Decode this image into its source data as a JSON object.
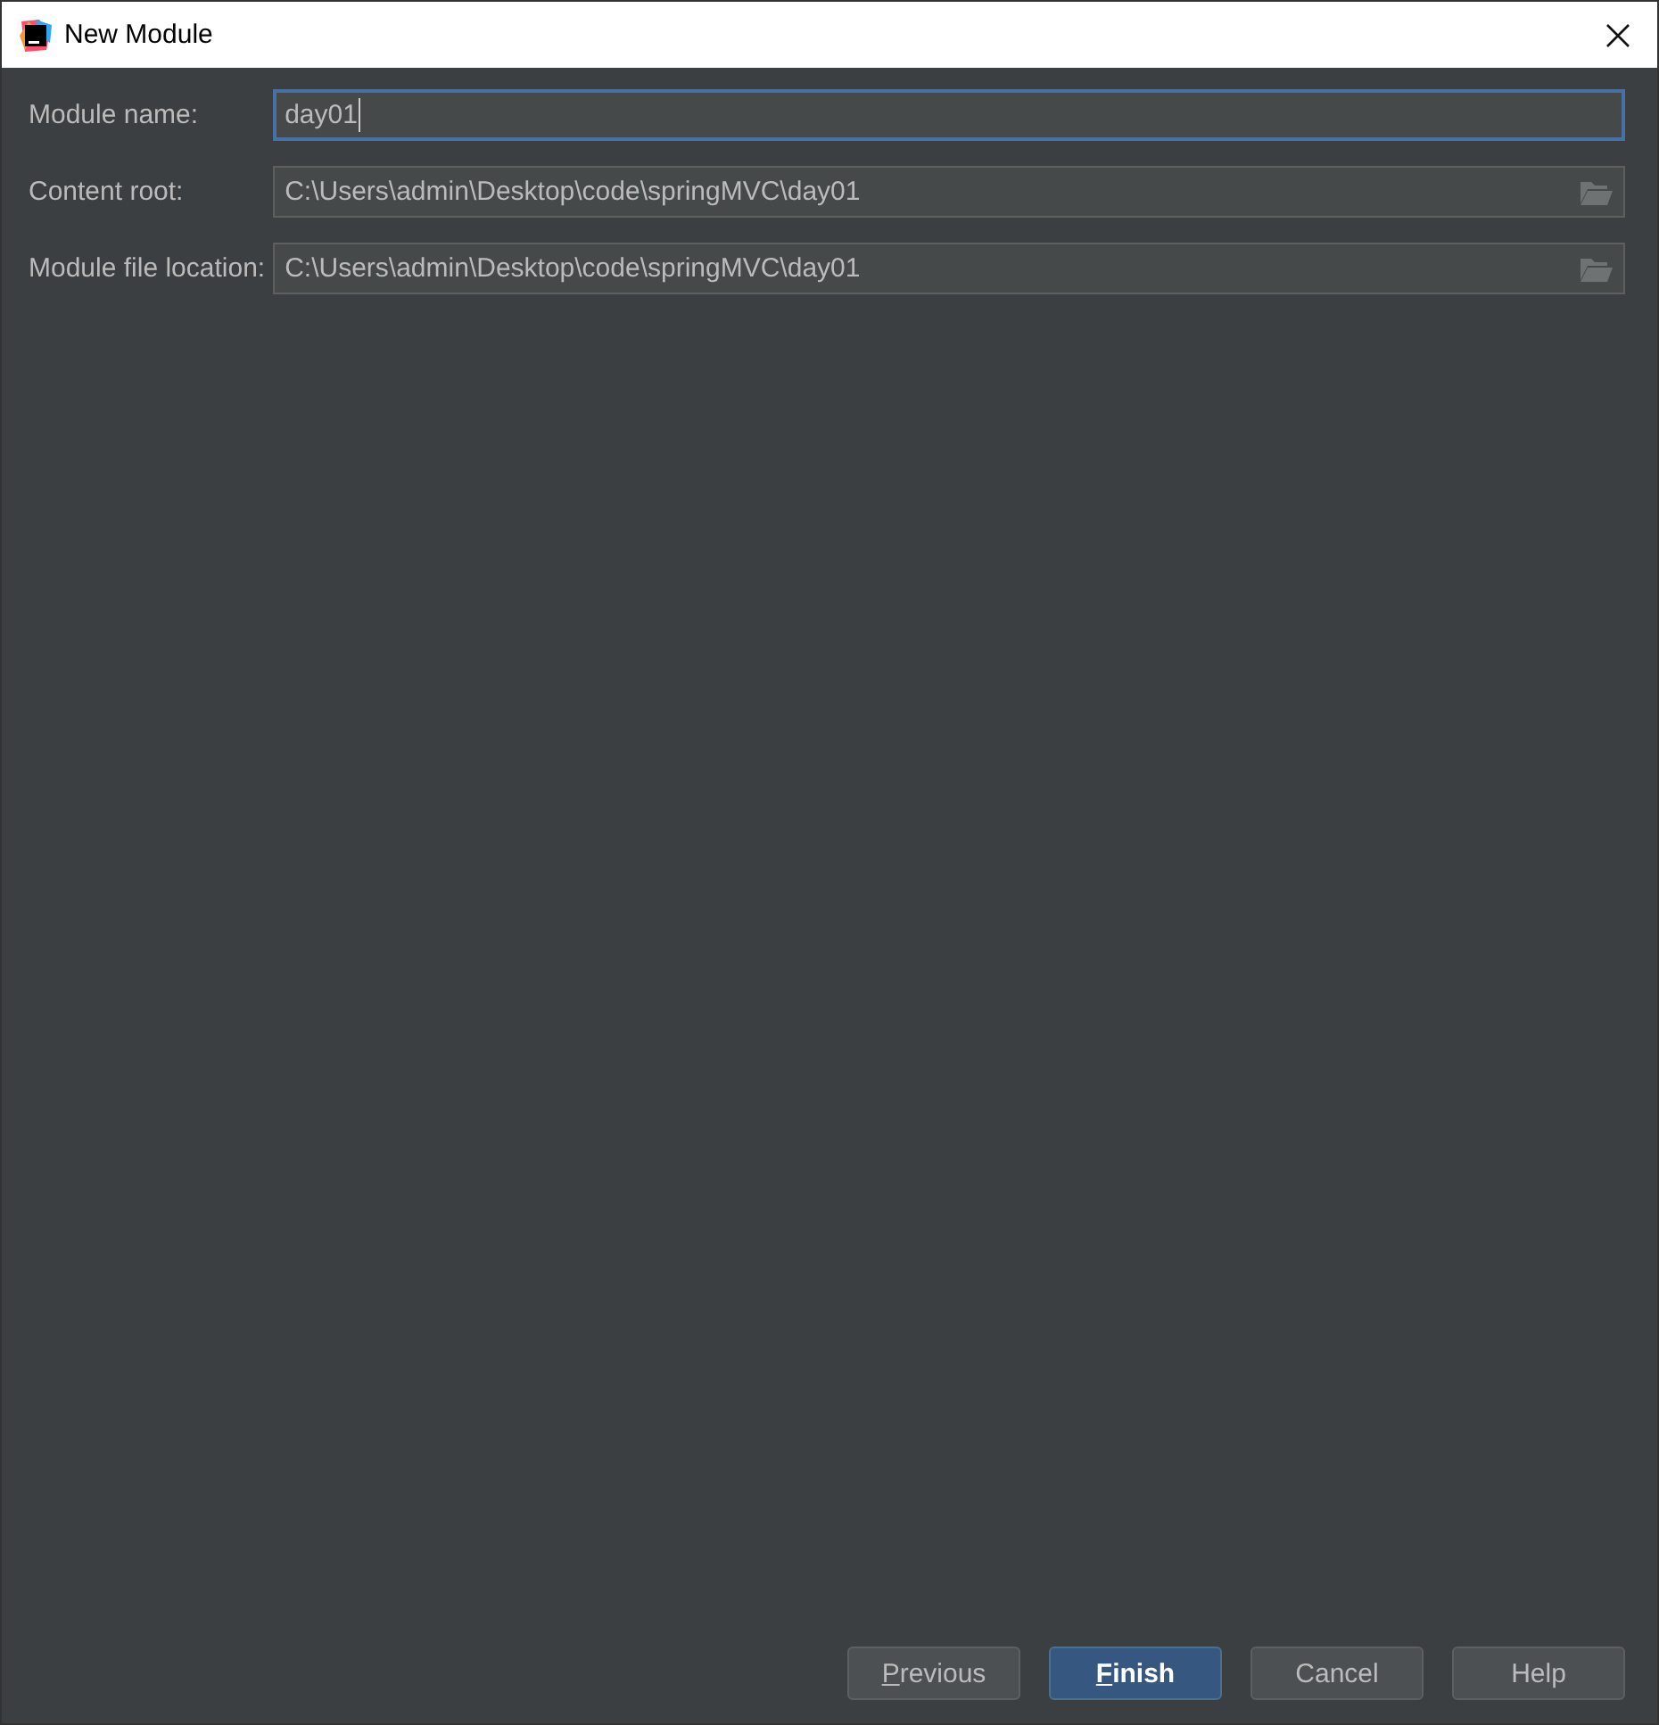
{
  "window": {
    "title": "New Module"
  },
  "fields": [
    {
      "label": "Module name:",
      "value": "day01",
      "focused": true,
      "browse": false
    },
    {
      "label": "Content root:",
      "value": "C:\\Users\\admin\\Desktop\\code\\springMVC\\day01",
      "focused": false,
      "browse": true
    },
    {
      "label": "Module file location:",
      "value": "C:\\Users\\admin\\Desktop\\code\\springMVC\\day01",
      "focused": false,
      "browse": true
    }
  ],
  "buttons": [
    {
      "label": "Previous",
      "default": false,
      "mnemonic": true
    },
    {
      "label": "Finish",
      "default": true,
      "mnemonic": true
    },
    {
      "label": "Cancel",
      "default": false,
      "mnemonic": false
    },
    {
      "label": "Help",
      "default": false,
      "mnemonic": false
    }
  ]
}
